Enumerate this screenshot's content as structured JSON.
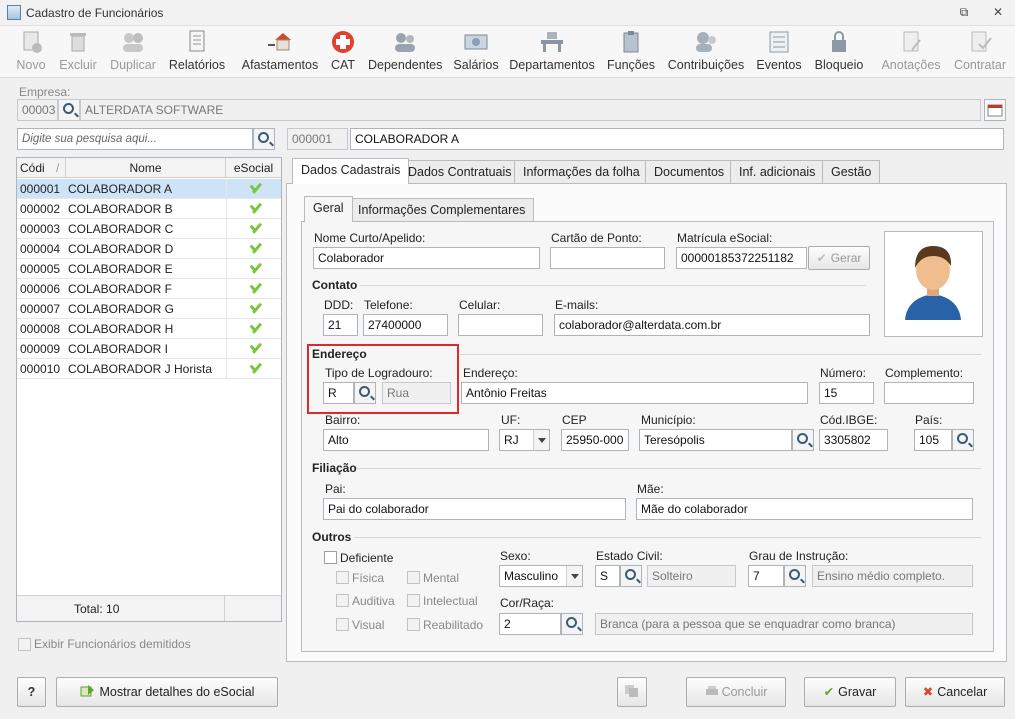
{
  "window": {
    "title": "Cadastro de Funcionários",
    "restore_glyph": "⧉",
    "close_glyph": "✕"
  },
  "toolbar": [
    {
      "label": "Novo",
      "icon": "new-doc-icon",
      "disabled": true
    },
    {
      "label": "Excluir",
      "icon": "trash-icon",
      "disabled": true
    },
    {
      "label": "Duplicar",
      "icon": "users-icon",
      "disabled": true
    },
    {
      "label": "Relatórios",
      "icon": "report-icon",
      "disabled": false
    },
    {
      "label": "Afastamentos",
      "icon": "house-arrow-icon",
      "disabled": false
    },
    {
      "label": "CAT",
      "icon": "red-cross-icon",
      "disabled": false
    },
    {
      "label": "Dependentes",
      "icon": "family-icon",
      "disabled": false
    },
    {
      "label": "Salários",
      "icon": "money-icon",
      "disabled": false
    },
    {
      "label": "Departamentos",
      "icon": "desk-icon",
      "disabled": false
    },
    {
      "label": "Funções",
      "icon": "badge-icon",
      "disabled": false
    },
    {
      "label": "Contribuições",
      "icon": "people-icon",
      "disabled": false
    },
    {
      "label": "Eventos",
      "icon": "list-icon",
      "disabled": false
    },
    {
      "label": "Bloqueio",
      "icon": "lock-icon",
      "disabled": false
    },
    {
      "label": "Anotações",
      "icon": "notes-icon",
      "disabled": true
    },
    {
      "label": "Contratar",
      "icon": "contract-icon",
      "disabled": true
    }
  ],
  "empresa": {
    "label": "Empresa:",
    "code": "00003",
    "name": "ALTERDATA SOFTWARE"
  },
  "search": {
    "placeholder": "Digite sua pesquisa aqui..."
  },
  "current": {
    "code": "000001",
    "name": "COLABORADOR A"
  },
  "list": {
    "headers": [
      "Códi",
      "Nome",
      "eSocial"
    ],
    "sort_glyph": "/",
    "rows": [
      {
        "code": "000001",
        "name": "COLABORADOR A"
      },
      {
        "code": "000002",
        "name": "COLABORADOR B"
      },
      {
        "code": "000003",
        "name": "COLABORADOR C"
      },
      {
        "code": "000004",
        "name": "COLABORADOR D"
      },
      {
        "code": "000005",
        "name": "COLABORADOR E"
      },
      {
        "code": "000006",
        "name": "COLABORADOR F"
      },
      {
        "code": "000007",
        "name": "COLABORADOR G"
      },
      {
        "code": "000008",
        "name": "COLABORADOR H"
      },
      {
        "code": "000009",
        "name": "COLABORADOR I"
      },
      {
        "code": "000010",
        "name": "COLABORADOR J Horista"
      }
    ],
    "total": "Total: 10",
    "show_dismissed": "Exibir Funcionários demitidos"
  },
  "tabs": [
    "Dados Cadastrais",
    "Dados Contratuais",
    "Informações da folha",
    "Documentos",
    "Inf. adicionais",
    "Gestão"
  ],
  "subtabs": [
    "Geral",
    "Informações Complementares"
  ],
  "form": {
    "nome_curto_label": "Nome Curto/Apelido:",
    "nome_curto": "Colaborador",
    "cartao_label": "Cartão de Ponto:",
    "cartao": "",
    "matricula_label": "Matrícula eSocial:",
    "matricula": "00000185372251182",
    "gerar": "Gerar",
    "contato": "Contato",
    "ddd_label": "DDD:",
    "ddd": "21",
    "telefone_label": "Telefone:",
    "telefone": "27400000",
    "celular_label": "Celular:",
    "celular": "",
    "email_label": "E-mails:",
    "email": "colaborador@alterdata.com.br",
    "endereco_sec": "Endereço",
    "tipo_label": "Tipo de Logradouro:",
    "tipo_code": "R",
    "tipo_name": "Rua",
    "endereco_label": "Endereço:",
    "endereco": "Antônio Freitas",
    "numero_label": "Número:",
    "numero": "15",
    "complemento_label": "Complemento:",
    "complemento": "",
    "bairro_label": "Bairro:",
    "bairro": "Alto",
    "uf_label": "UF:",
    "uf": "RJ",
    "cep_label": "CEP",
    "cep": "25950-000",
    "municipio_label": "Município:",
    "municipio": "Teresópolis",
    "ibge_label": "Cód.IBGE:",
    "ibge": "3305802",
    "pais_label": "País:",
    "pais": "105",
    "filiacao": "Filiação",
    "pai_label": "Pai:",
    "pai": "Pai do colaborador",
    "mae_label": "Mãe:",
    "mae": "Mãe do colaborador",
    "outros": "Outros",
    "deficiente": "Deficiente",
    "fisica": "Física",
    "mental": "Mental",
    "auditiva": "Auditiva",
    "intelectual": "Intelectual",
    "visual": "Visual",
    "reabilitado": "Reabilitado",
    "sexo_label": "Sexo:",
    "sexo": "Masculino",
    "estado_label": "Estado Civil:",
    "estado_code": "S",
    "estado_name": "Solteiro",
    "grau_label": "Grau de Instrução:",
    "grau_code": "7",
    "grau_name": "Ensino médio completo.",
    "cor_label": "Cor/Raça:",
    "cor_code": "2",
    "cor_name": "Branca (para a pessoa que se enquadrar como branca)"
  },
  "footer": {
    "help": "?",
    "esocial_btn": "Mostrar detalhes do eSocial",
    "concluir": "Concluir",
    "gravar": "Gravar",
    "cancelar": "Cancelar"
  },
  "colors": {
    "highlight": "#d92b2b",
    "check": "#7cc540",
    "selected_row": "#cfe3f7",
    "cancel_x": "#d94a2b",
    "gravar_check": "#5aa832"
  }
}
